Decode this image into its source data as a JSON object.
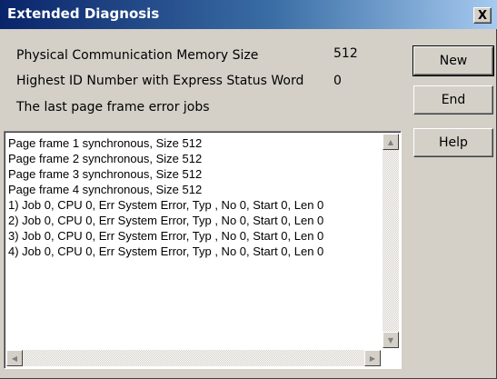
{
  "window": {
    "title": "Extended Diagnosis",
    "close_label": "X"
  },
  "info": {
    "mem_label": "Physical Communication Memory Size",
    "mem_value": "512",
    "id_label": "Highest ID Number with Express Status Word",
    "id_value": "0",
    "errors_label": "The last page frame error jobs"
  },
  "buttons": {
    "new": "New",
    "end": "End",
    "help": "Help"
  },
  "list": {
    "lines": [
      "Page frame 1 synchronous, Size 512",
      "Page frame 2 synchronous, Size 512",
      "Page frame 3 synchronous, Size 512",
      "Page frame 4 synchronous, Size 512",
      "1) Job 0, CPU 0, Err System Error, Typ , No 0, Start 0, Len 0",
      "2) Job 0, CPU 0, Err System Error, Typ , No 0, Start 0, Len 0",
      "3) Job 0, CPU 0, Err System Error, Typ , No 0, Start 0, Len 0",
      "4) Job 0, CPU 0, Err System Error, Typ , No 0, Start 0, Len 0"
    ]
  },
  "scroll": {
    "up_icon": "arrow-up-icon",
    "down_icon": "arrow-down-icon",
    "left_icon": "arrow-left-icon",
    "right_icon": "arrow-right-icon"
  }
}
